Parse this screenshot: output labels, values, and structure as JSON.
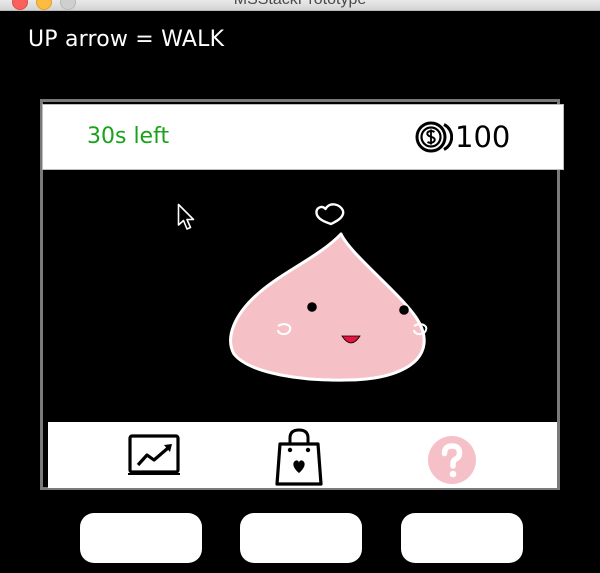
{
  "window": {
    "title": "MSStackPrototype"
  },
  "hint": {
    "text": "UP arrow = WALK"
  },
  "status": {
    "timer_text": "30s left",
    "coin_icon": "coin-icon",
    "coin_count": "100",
    "timer_color": "#1aa11a"
  },
  "character": {
    "name": "pink-blob-pet",
    "body_color": "#f6c1c6",
    "accessory_icon": "heart-icon"
  },
  "nav": {
    "items": [
      {
        "icon": "chart-icon",
        "label": "stats"
      },
      {
        "icon": "shopping-bag-icon",
        "label": "shop"
      },
      {
        "icon": "help-icon",
        "label": "help",
        "color": "#f5c0c8"
      }
    ]
  },
  "hardware_buttons": [
    "left",
    "middle",
    "right"
  ]
}
